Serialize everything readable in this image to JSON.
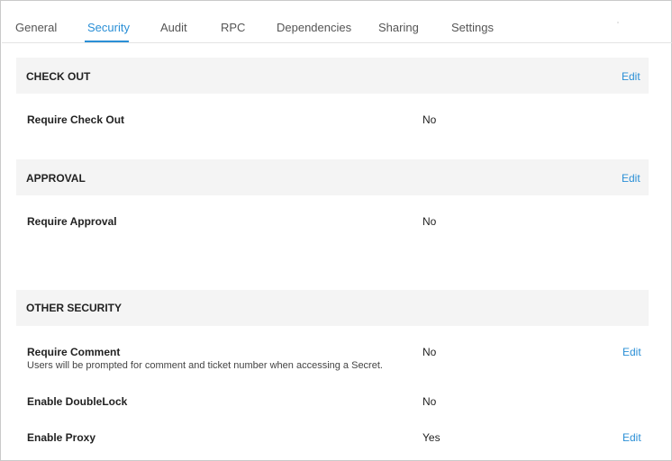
{
  "tabs": [
    {
      "label": "General"
    },
    {
      "label": "Security"
    },
    {
      "label": "Audit"
    },
    {
      "label": "RPC"
    },
    {
      "label": "Dependencies"
    },
    {
      "label": "Sharing"
    },
    {
      "label": "Settings"
    }
  ],
  "active_tab": "Security",
  "accent_color": "#2a8fd6",
  "sections": {
    "checkout": {
      "title": "CHECK OUT",
      "edit_label": "Edit",
      "rows": [
        {
          "label": "Require Check Out",
          "value": "No"
        }
      ]
    },
    "approval": {
      "title": "APPROVAL",
      "edit_label": "Edit",
      "rows": [
        {
          "label": "Require Approval",
          "value": "No"
        }
      ]
    },
    "other": {
      "title": "OTHER SECURITY",
      "rows": [
        {
          "label": "Require Comment",
          "description": "Users will be prompted for comment and ticket number when accessing a Secret.",
          "value": "No",
          "edit_label": "Edit"
        },
        {
          "label": "Enable DoubleLock",
          "value": "No"
        },
        {
          "label": "Enable Proxy",
          "value": "Yes",
          "edit_label": "Edit"
        }
      ]
    }
  }
}
